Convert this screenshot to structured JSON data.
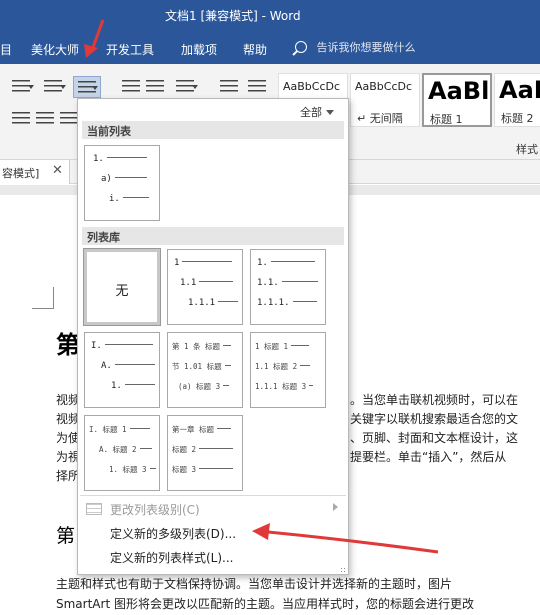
{
  "window": {
    "title": "文档1 [兼容模式] - Word"
  },
  "tabs": [
    {
      "label": "美化大师"
    },
    {
      "label": "开发工具"
    },
    {
      "label": "加载项"
    },
    {
      "label": "帮助"
    }
  ],
  "tell_me": {
    "placeholder": "告诉我你想要做什么"
  },
  "styles": [
    {
      "sample": "AaBbCcDc",
      "name": ""
    },
    {
      "sample": "AaBbCcDc",
      "name": "↵ 无间隔"
    },
    {
      "sample": "AaBl",
      "name": "标题 1"
    },
    {
      "sample": "AaBl",
      "name": "标题 2"
    }
  ],
  "styles_group_label": "样式",
  "doc_tab": {
    "label": "容模式]",
    "close": "✕"
  },
  "menu": {
    "all_label": "全部",
    "current_list_title": "当前列表",
    "library_title": "列表库",
    "none_label": "无",
    "items": [
      {
        "label": "更改列表级别(C)",
        "enabled": false
      },
      {
        "label": "定义新的多级列表(D)...",
        "enabled": true
      },
      {
        "label": "定义新的列表样式(L)...",
        "enabled": true
      }
    ]
  },
  "thumbs": {
    "current": [
      "1.",
      "a)",
      "i."
    ],
    "lib_1": [
      "1",
      "1.1",
      "1.1.1"
    ],
    "lib_2": [
      "1.",
      "1.1.",
      "1.1.1."
    ],
    "lib_3": [
      "I.",
      "A.",
      "1."
    ],
    "lib_4": [
      "第 1 条 标题",
      "节 1.01 标题",
      "(a) 标题 3"
    ],
    "lib_5": [
      "1 标题 1",
      "1.1 标题 2",
      "1.1.1 标题 3"
    ],
    "lib_6": [
      "I. 标题 1",
      "A. 标题 2",
      "1. 标题 3"
    ],
    "lib_7": [
      "第一章 标题",
      "标题 2",
      "标题 3"
    ]
  },
  "document": {
    "heading_1": "第",
    "heading_2": "第",
    "lines": [
      "视频",
      "视频",
      "为使",
      "为視",
      "择所",
      "。当您单击联机视频时，可以在",
      "关键字以联机搜索最适合您的文",
      "、页脚、封面和文本框设计，这",
      "提要栏。单击“插入”，然后从",
      "主题和样式也有助于文档保持协调。当您单击设计并选择新的主题时，图片",
      "SmartArt 图形将会更改以匹配新的主题。当应用样式时，您的标题会进行更改"
    ]
  },
  "colors": {
    "accent": "#2b579a",
    "annotation_arrow": "#e0393a"
  }
}
